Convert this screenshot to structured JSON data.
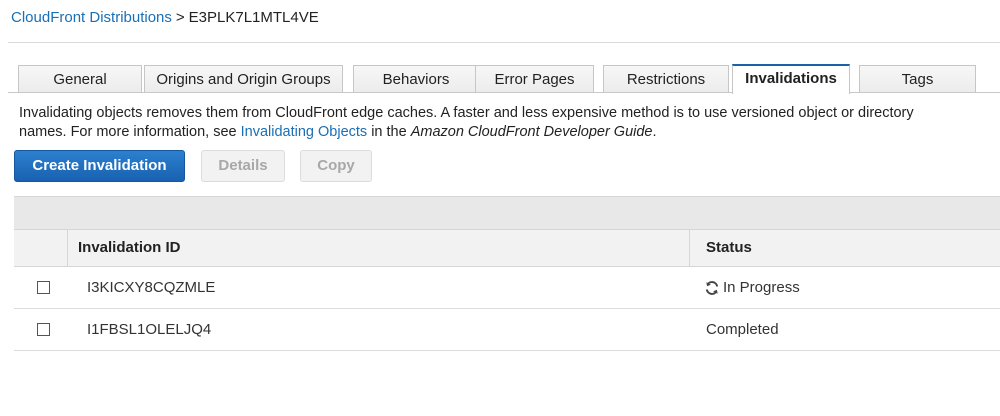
{
  "breadcrumb": {
    "parent": "CloudFront Distributions",
    "separator": ">",
    "current": "E3PLK7L1MTL4VE"
  },
  "tabs": [
    {
      "label": "General"
    },
    {
      "label": "Origins and Origin Groups"
    },
    {
      "label": "Behaviors"
    },
    {
      "label": "Error Pages"
    },
    {
      "label": "Restrictions"
    },
    {
      "label": "Invalidations",
      "active": true
    },
    {
      "label": "Tags"
    }
  ],
  "description": {
    "text1": "Invalidating objects removes them from CloudFront edge caches. A faster and less expensive method is to use versioned object or directory names. For more information, see ",
    "link": "Invalidating Objects",
    "text2": " in the ",
    "guide": "Amazon CloudFront Developer Guide",
    "text3": "."
  },
  "buttons": {
    "create": "Create Invalidation",
    "details": "Details",
    "copy": "Copy"
  },
  "table": {
    "columns": {
      "id": "Invalidation ID",
      "status": "Status"
    },
    "rows": [
      {
        "id": "I3KICXY8CQZMLE",
        "status": "In Progress",
        "icon": "refresh-icon"
      },
      {
        "id": "I1FBSL1OLELJQ4",
        "status": "Completed"
      }
    ]
  },
  "colors": {
    "link": "#1a6fb5",
    "primary": "#1862b0",
    "active_tab_border": "#1b62a8"
  }
}
